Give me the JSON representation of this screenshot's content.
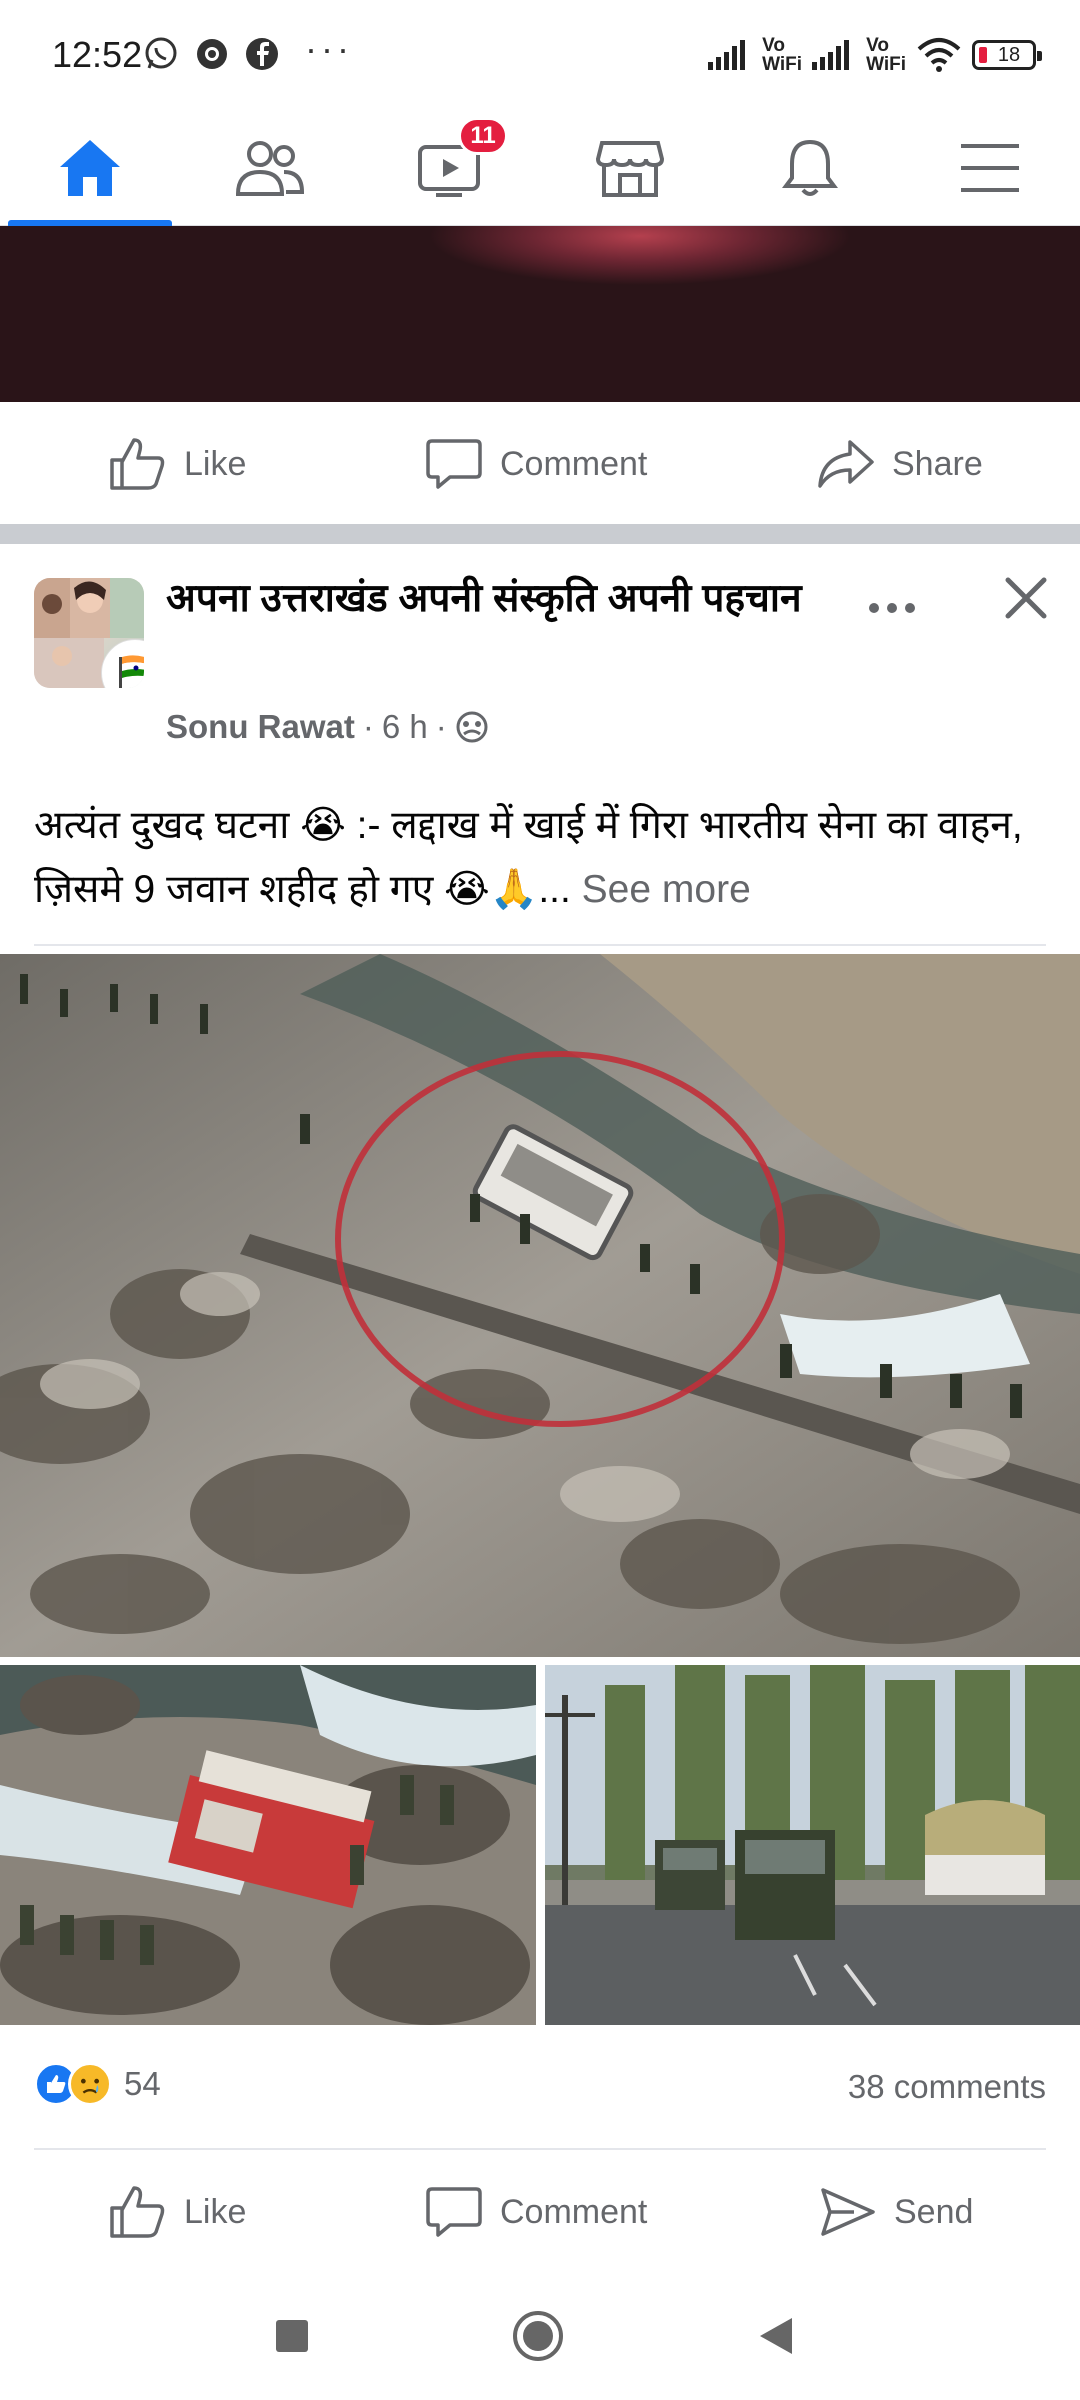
{
  "status_bar": {
    "time": "12:52",
    "notification_icons": [
      "whatsapp-icon",
      "chrome-icon",
      "facebook-icon"
    ],
    "more": "···",
    "vowifi_1": "Vo\nWiFi",
    "vowifi_2": "Vo\nWiFi",
    "battery": "18"
  },
  "nav": {
    "tabs": [
      {
        "name": "home",
        "icon": "home-icon",
        "active": true
      },
      {
        "name": "friends",
        "icon": "friends-icon"
      },
      {
        "name": "watch",
        "icon": "watch-icon",
        "badge": "11"
      },
      {
        "name": "marketplace",
        "icon": "marketplace-icon"
      },
      {
        "name": "notifications",
        "icon": "bell-icon"
      },
      {
        "name": "menu",
        "icon": "menu-icon"
      }
    ],
    "accent": "#1877f2"
  },
  "prev_post": {
    "like": "Like",
    "comment": "Comment",
    "share": "Share"
  },
  "post": {
    "group_name": "अपना उत्तराखंड अपनी संस्कृति अपनी पहचान",
    "author": "Sonu Rawat",
    "dot1": "·",
    "time": "6 h",
    "dot2": "·",
    "text": "अत्यंत दुखद घटना 😭 :-  लद्दाख में खाई में गिरा भारतीय सेना का वाहन, ज़िसमे 9 जवान शहीद हो गए 😭🙏",
    "ellipsis": "...",
    "see_more": "See more",
    "reaction_count": "54",
    "comments": "38 comments",
    "like": "Like",
    "comment": "Comment",
    "send": "Send"
  }
}
